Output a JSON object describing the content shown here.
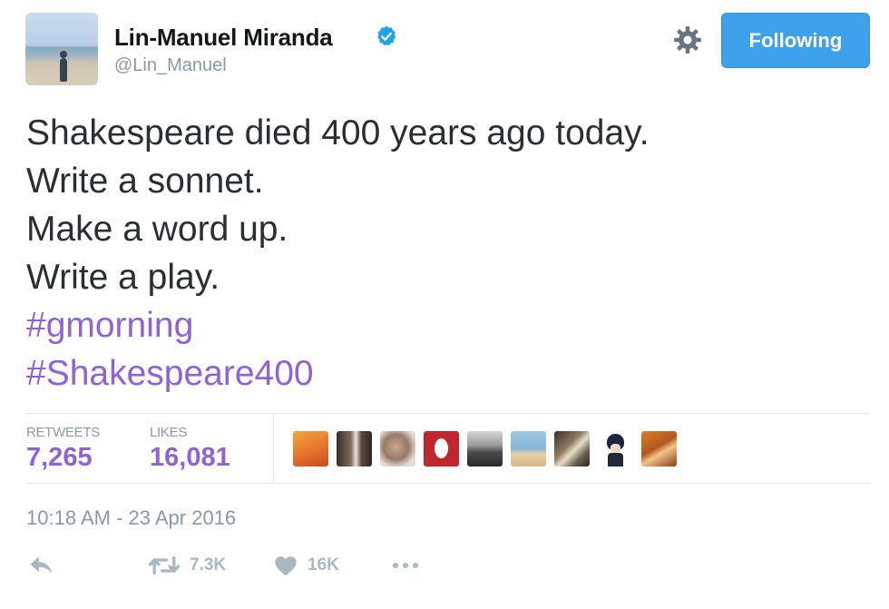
{
  "author": {
    "name": "Lin-Manuel Miranda",
    "handle": "@Lin_Manuel",
    "verified": true
  },
  "follow_button": {
    "label": "Following",
    "color": "#3ea1ec"
  },
  "tweet": {
    "lines": [
      "Shakespeare died 400 years ago today.",
      "Write a sonnet.",
      "Make a word up.",
      "Write a play."
    ],
    "hashtags": [
      "#gmorning",
      "#Shakespeare400"
    ],
    "hashtag_color": "#8e63d9"
  },
  "stats": {
    "retweets_label": "RETWEETS",
    "retweets_value": "7,265",
    "likes_label": "LIKES",
    "likes_value": "16,081"
  },
  "likers": [
    {
      "icon": "liker-avatar-1",
      "color": "#e8772e"
    },
    {
      "icon": "liker-avatar-2",
      "color": "#5a4a42"
    },
    {
      "icon": "liker-avatar-3",
      "color": "#b79a86"
    },
    {
      "icon": "liker-avatar-4",
      "color": "#c0262e"
    },
    {
      "icon": "liker-avatar-5",
      "color": "#4b4b4b"
    },
    {
      "icon": "liker-avatar-6",
      "color": "#86b7d6"
    },
    {
      "icon": "liker-avatar-7",
      "color": "#6e6250"
    },
    {
      "icon": "liker-avatar-8",
      "color": "#222a3a"
    },
    {
      "icon": "liker-avatar-9",
      "color": "#b0571f"
    }
  ],
  "timestamp": "10:18 AM - 23 Apr 2016",
  "actions": {
    "reply_icon": "reply-icon",
    "retweet_icon": "retweet-icon",
    "retweet_count": "7.3K",
    "like_icon": "heart-icon",
    "like_count": "16K",
    "more_icon": "more-icon"
  }
}
